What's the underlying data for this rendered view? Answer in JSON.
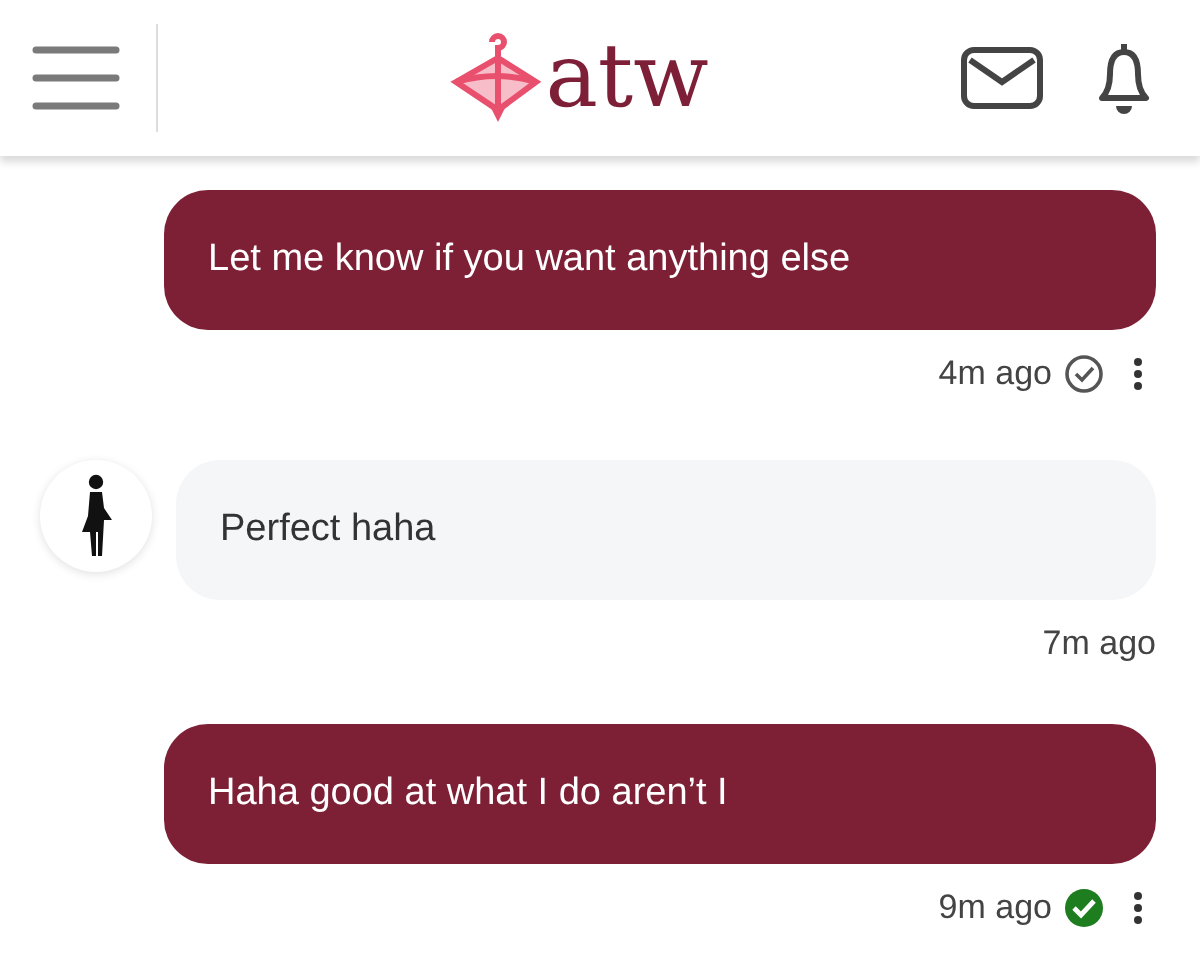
{
  "header": {
    "logo_text": "atw"
  },
  "messages": [
    {
      "kind": "sent",
      "text": "Let me know if you want anything else",
      "time": "4m ago",
      "read": false
    },
    {
      "kind": "received",
      "text": "Perfect haha",
      "time": "7m ago"
    },
    {
      "kind": "sent",
      "text": "Haha good at what I do aren’t I",
      "time": "9m ago",
      "read": true
    }
  ]
}
